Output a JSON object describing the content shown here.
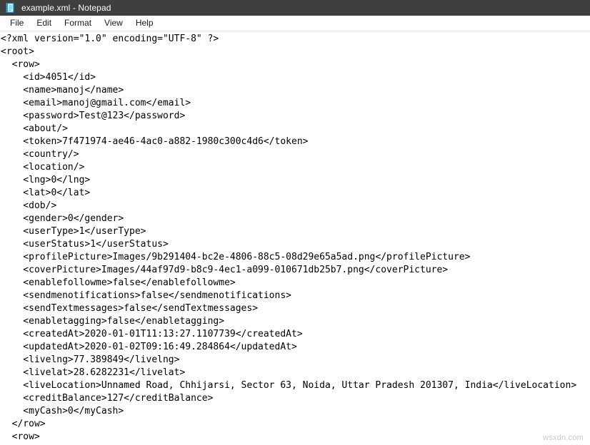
{
  "window": {
    "title": "example.xml - Notepad",
    "icon": "notepad-document-icon",
    "titlebar_color": "#3f3f3f",
    "titlebar_text_color": "#ffffff",
    "background_color": "#ffffff"
  },
  "menu": {
    "items": [
      {
        "label": "File"
      },
      {
        "label": "Edit"
      },
      {
        "label": "Format"
      },
      {
        "label": "View"
      },
      {
        "label": "Help"
      }
    ]
  },
  "editor": {
    "font": "monospace",
    "text_color": "#000000",
    "lines": [
      "<?xml version=\"1.0\" encoding=\"UTF-8\" ?>",
      "<root>",
      "  <row>",
      "    <id>4051</id>",
      "    <name>manoj</name>",
      "    <email>manoj@gmail.com</email>",
      "    <password>Test@123</password>",
      "    <about/>",
      "    <token>7f471974-ae46-4ac0-a882-1980c300c4d6</token>",
      "    <country/>",
      "    <location/>",
      "    <lng>0</lng>",
      "    <lat>0</lat>",
      "    <dob/>",
      "    <gender>0</gender>",
      "    <userType>1</userType>",
      "    <userStatus>1</userStatus>",
      "    <profilePicture>Images/9b291404-bc2e-4806-88c5-08d29e65a5ad.png</profilePicture>",
      "    <coverPicture>Images/44af97d9-b8c9-4ec1-a099-010671db25b7.png</coverPicture>",
      "    <enablefollowme>false</enablefollowme>",
      "    <sendmenotifications>false</sendmenotifications>",
      "    <sendTextmessages>false</sendTextmessages>",
      "    <enabletagging>false</enabletagging>",
      "    <createdAt>2020-01-01T11:13:27.1107739</createdAt>",
      "    <updatedAt>2020-01-02T09:16:49.284864</updatedAt>",
      "    <livelng>77.389849</livelng>",
      "    <livelat>28.6282231</livelat>",
      "    <liveLocation>Unnamed Road, Chhijarsi, Sector 63, Noida, Uttar Pradesh 201307, India</liveLocation>",
      "    <creditBalance>127</creditBalance>",
      "    <myCash>0</myCash>",
      "  </row>",
      "  <row>"
    ]
  },
  "watermark": {
    "text": "wsxdn.com"
  }
}
